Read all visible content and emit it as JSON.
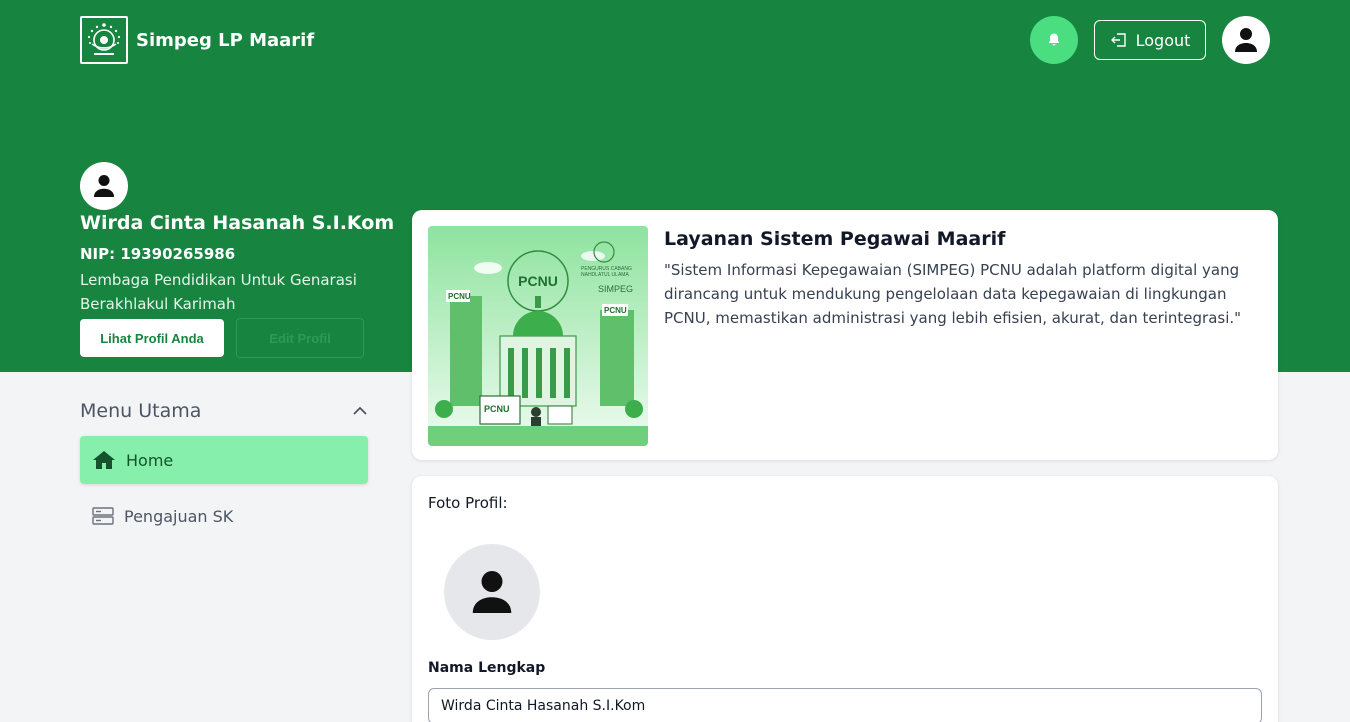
{
  "header": {
    "brand_title": "Simpeg LP Maarif",
    "logout_label": "Logout"
  },
  "profile": {
    "name": "Wirda Cinta Hasanah S.I.Kom",
    "nip": "NIP: 19390265986",
    "tagline": "Lembaga Pendidikan Untuk Genarasi Berakhlakul Karimah",
    "view_profile_label": "Lihat Profil Anda",
    "edit_profile_label": "Edit Profil"
  },
  "sidebar": {
    "title": "Menu Utama",
    "items": [
      {
        "label": "Home",
        "icon": "home-icon",
        "active": true
      },
      {
        "label": "Pengajuan SK",
        "icon": "server-icon",
        "active": false
      }
    ]
  },
  "info_card": {
    "title": "Layanan Sistem Pegawai Maarif",
    "description": "\"Sistem Informasi Kepegawaian (SIMPEG) PCNU adalah platform digital yang dirancang untuk mendukung pengelolaan data kepegawaian di lingkungan PCNU, memastikan administrasi yang lebih efisien, akurat, dan terintegrasi.\"",
    "image_texts": {
      "sign_main": "PCNU",
      "sign_left": "PCNU",
      "sign_right": "PCNU",
      "monitor": "PCNU",
      "simpeg": "SIMPEG",
      "emblem_top": "PENGURUS CABANG",
      "emblem_bottom": "NAHDLATUL ULAMA"
    }
  },
  "profile_form": {
    "photo_label": "Foto Profil:",
    "full_name_label": "Nama Lengkap",
    "full_name_value": "Wirda Cinta Hasanah S.I.Kom"
  },
  "colors": {
    "brand_green": "#178540",
    "accent_green": "#4ade80",
    "active_menu": "#86efac"
  }
}
